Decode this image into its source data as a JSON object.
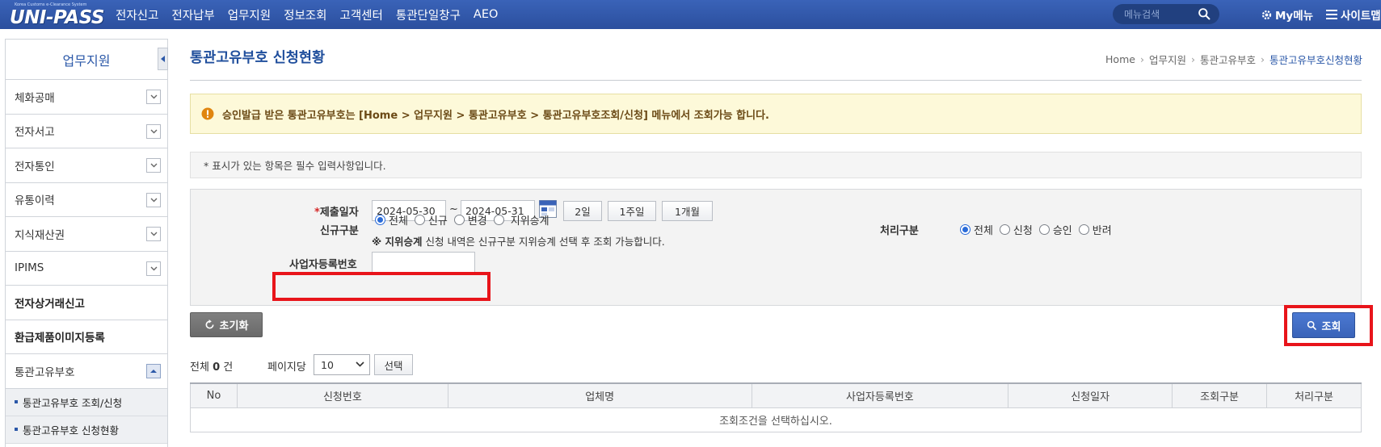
{
  "header": {
    "logo_text": "UNI-PASS",
    "logo_subtext": "Korea Customs e-Clearance System",
    "nav": [
      "전자신고",
      "전자납부",
      "업무지원",
      "정보조회",
      "고객센터",
      "통관단일창구",
      "AEO"
    ],
    "search_placeholder": "메뉴검색",
    "mymenu_label": "My메뉴",
    "sitemap_label": "사이트맵"
  },
  "sidebar": {
    "title": "업무지원",
    "items": [
      {
        "label": "체화공매"
      },
      {
        "label": "전자서고"
      },
      {
        "label": "전자통인"
      },
      {
        "label": "유통이력"
      },
      {
        "label": "지식재산권"
      },
      {
        "label": "IPIMS"
      },
      {
        "label": "전자상거래신고"
      },
      {
        "label": "환급제품이미지등록"
      },
      {
        "label": "통관고유부호"
      }
    ],
    "subitems": [
      "통관고유부호 조회/신청",
      "통관고유부호 신청현황"
    ]
  },
  "page": {
    "title": "통관고유부호 신청현황",
    "breadcrumb": [
      "Home",
      "업무지원",
      "통관고유부호",
      "통관고유부호신청현황"
    ],
    "notice": "승인발급 받은 통관고유부호는 [Home > 업무지원 > 통관고유부호 > 통관고유부호조회/신청] 메뉴에서 조회가능 합니다.",
    "required_note": "* 표시가 있는 항목은 필수 입력사항입니다."
  },
  "form": {
    "date_label_star": "*",
    "date_label": "제출일자",
    "date_from": "2024-05-30",
    "date_tilde": "~",
    "date_to": "2024-05-31",
    "period_buttons": [
      "2일",
      "1주일",
      "1개월"
    ],
    "type_label": "신규구분",
    "type_options": [
      "전체",
      "신규",
      "변경",
      "지위승계"
    ],
    "type_note_bold": "※ 지위승계",
    "type_note": " 신청 내역은 신규구분 지위승계 선택 후 조회 가능합니다.",
    "process_label": "처리구분",
    "process_options": [
      "전체",
      "신청",
      "승인",
      "반려"
    ],
    "biz_label": "사업자등록번호",
    "biz_value": ""
  },
  "actions": {
    "reset_label": "초기화",
    "search_label": "조회"
  },
  "list": {
    "total_prefix": "전체 ",
    "total_count": "0",
    "total_suffix": " 건",
    "perpage_label": "페이지당",
    "perpage_value": "10",
    "select_button": "선택",
    "columns": [
      "No",
      "신청번호",
      "업체명",
      "사업자등록번호",
      "신청일자",
      "조회구분",
      "처리구분"
    ],
    "empty_message": "조회조건을 선택하십시오."
  }
}
